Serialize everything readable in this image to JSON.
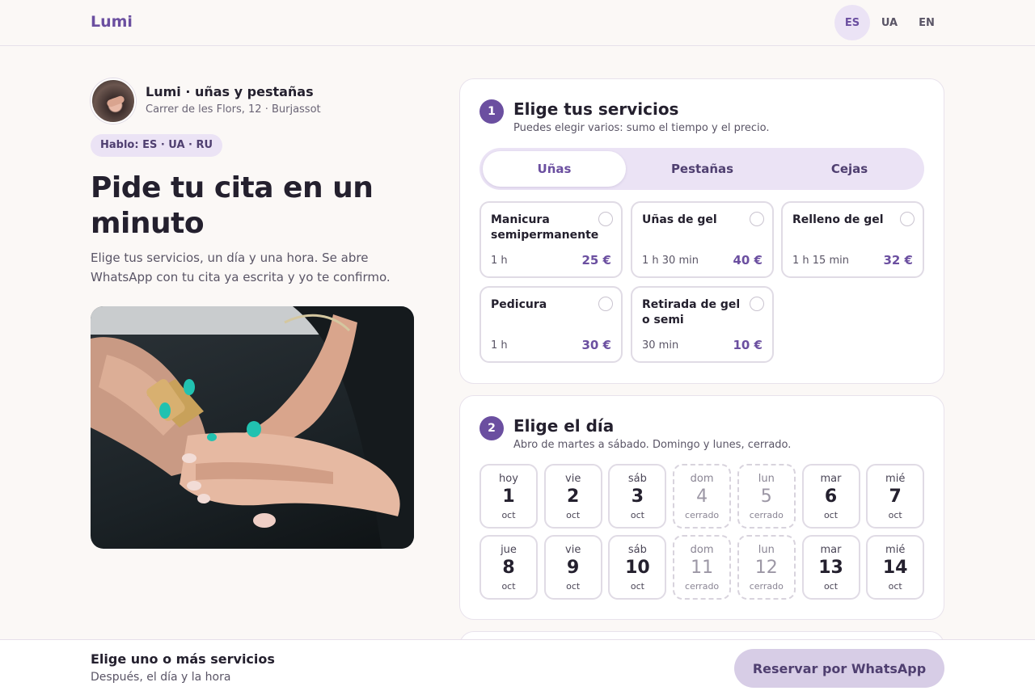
{
  "header": {
    "logo": "Lumi",
    "languages": [
      {
        "code": "ES",
        "active": true
      },
      {
        "code": "UA",
        "active": false
      },
      {
        "code": "EN",
        "active": false
      }
    ]
  },
  "business": {
    "name": "Lumi · uñas y pestañas",
    "address": "Carrer de les Flors, 12 · Burjassot",
    "languages_badge": "Hablo: ES · UA · RU"
  },
  "hero": {
    "title": "Pide tu cita en un minuto",
    "subtitle": "Elige tus servicios, un día y una hora. Se abre WhatsApp con tu cita ya escrita y yo te confirmo."
  },
  "step1": {
    "number": "1",
    "title": "Elige tus servicios",
    "subtitle": "Puedes elegir varios: sumo el tiempo y el precio.",
    "tabs": [
      {
        "label": "Uñas",
        "active": true
      },
      {
        "label": "Pestañas",
        "active": false
      },
      {
        "label": "Cejas",
        "active": false
      }
    ],
    "services": [
      {
        "name": "Manicura semipermanente",
        "duration": "1 h",
        "price": "25 €"
      },
      {
        "name": "Uñas de gel",
        "duration": "1 h 30 min",
        "price": "40 €"
      },
      {
        "name": "Relleno de gel",
        "duration": "1 h 15 min",
        "price": "32 €"
      },
      {
        "name": "Pedicura",
        "duration": "1 h",
        "price": "30 €"
      },
      {
        "name": "Retirada de gel o semi",
        "duration": "30 min",
        "price": "10 €"
      }
    ]
  },
  "step2": {
    "number": "2",
    "title": "Elige el día",
    "subtitle": "Abro de martes a sábado. Domingo y lunes, cerrado.",
    "days": [
      {
        "weekday": "hoy",
        "day": "1",
        "month": "oct",
        "closed": false
      },
      {
        "weekday": "vie",
        "day": "2",
        "month": "oct",
        "closed": false
      },
      {
        "weekday": "sáb",
        "day": "3",
        "month": "oct",
        "closed": false
      },
      {
        "weekday": "dom",
        "day": "4",
        "month": "cerrado",
        "closed": true
      },
      {
        "weekday": "lun",
        "day": "5",
        "month": "cerrado",
        "closed": true
      },
      {
        "weekday": "mar",
        "day": "6",
        "month": "oct",
        "closed": false
      },
      {
        "weekday": "mié",
        "day": "7",
        "month": "oct",
        "closed": false
      },
      {
        "weekday": "jue",
        "day": "8",
        "month": "oct",
        "closed": false
      },
      {
        "weekday": "vie",
        "day": "9",
        "month": "oct",
        "closed": false
      },
      {
        "weekday": "sáb",
        "day": "10",
        "month": "oct",
        "closed": false
      },
      {
        "weekday": "dom",
        "day": "11",
        "month": "cerrado",
        "closed": true
      },
      {
        "weekday": "lun",
        "day": "12",
        "month": "cerrado",
        "closed": true
      },
      {
        "weekday": "mar",
        "day": "13",
        "month": "oct",
        "closed": false
      },
      {
        "weekday": "mié",
        "day": "14",
        "month": "oct",
        "closed": false
      }
    ]
  },
  "bottom_bar": {
    "title": "Elige uno o más servicios",
    "subtitle": "Después, el día y la hora",
    "button": "Reservar por WhatsApp"
  },
  "colors": {
    "accent": "#6b4fa0",
    "accent_soft": "#ebe3f5",
    "background": "#fbf8f6",
    "button_disabled": "#d7cde6"
  }
}
